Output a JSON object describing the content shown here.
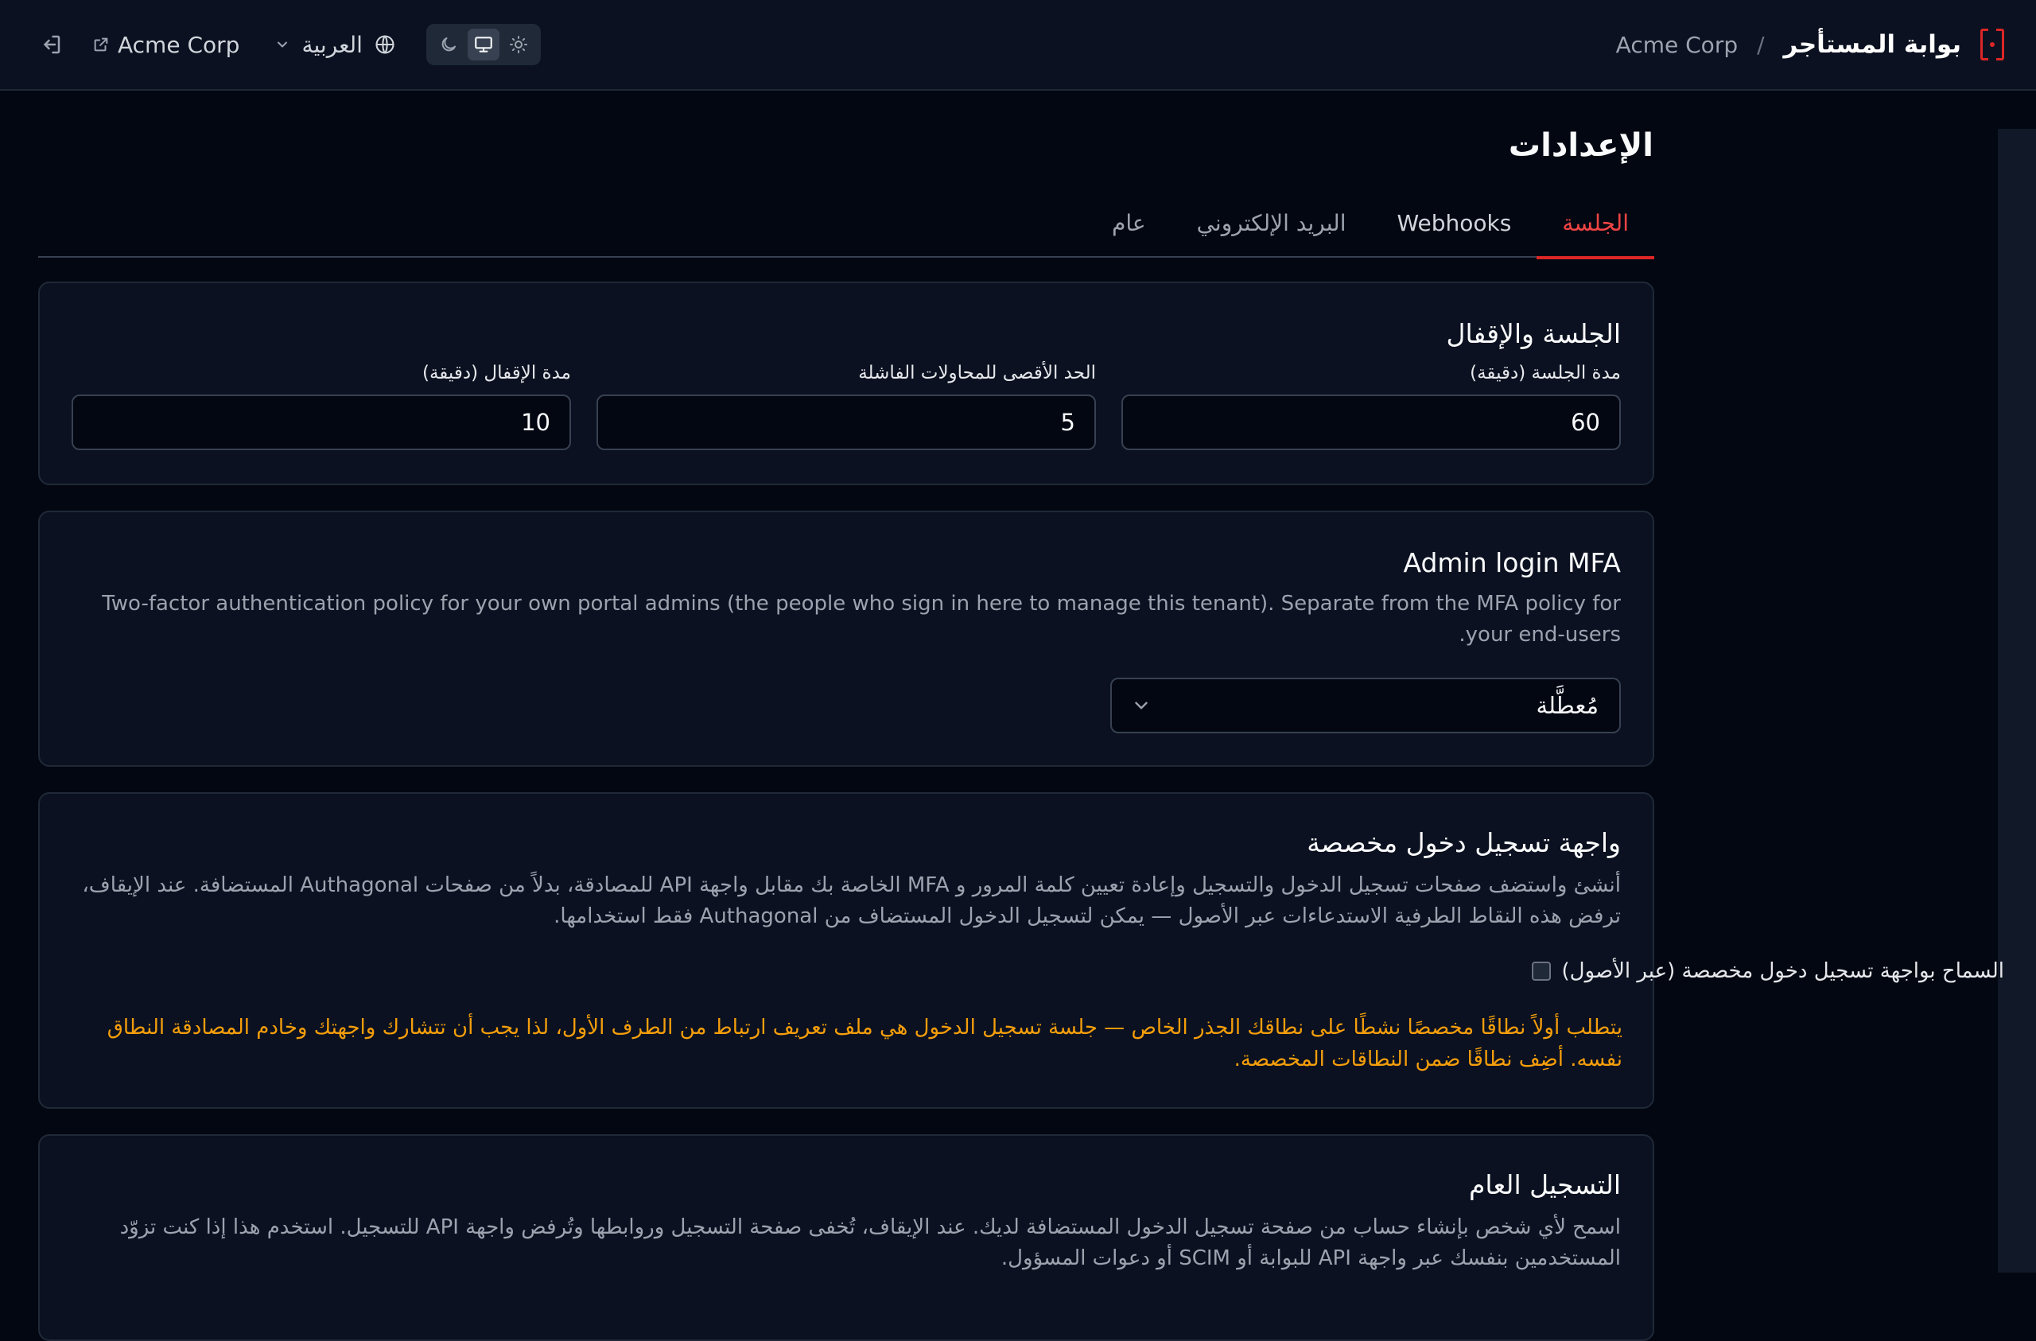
{
  "header": {
    "app_title": "بوابة المستأجر",
    "separator": "/",
    "tenant_name": "Acme Corp",
    "tenant_link_label": "Acme Corp",
    "language_label": "العربية",
    "theme_options": [
      "dark",
      "system",
      "light"
    ],
    "theme_selected": "system"
  },
  "page": {
    "title": "الإعدادات"
  },
  "tabs": [
    {
      "label": "الجلسة",
      "active": true
    },
    {
      "label": "Webhooks",
      "active": false
    },
    {
      "label": "البريد الإلكتروني",
      "active": false
    },
    {
      "label": "عام",
      "active": false
    }
  ],
  "session_card": {
    "title": "الجلسة والإقفال",
    "session_duration_label": "مدة الجلسة (دقيقة)",
    "session_duration_value": "60",
    "max_failed_label": "الحد الأقصى للمحاولات الفاشلة",
    "max_failed_value": "5",
    "lockout_label": "مدة الإقفال (دقيقة)",
    "lockout_value": "10"
  },
  "mfa_card": {
    "title": "Admin login MFA",
    "description": "Two-factor authentication policy for your own portal admins (the people who sign in here to manage this tenant). Separate from the MFA policy for your end-users.",
    "select_value": "مُعطَّلة"
  },
  "custom_login_card": {
    "title": "واجهة تسجيل دخول مخصصة",
    "description": "أنشئ واستضف صفحات تسجيل الدخول والتسجيل وإعادة تعيين كلمة المرور و MFA الخاصة بك مقابل واجهة API للمصادقة، بدلاً من صفحات Authagonal المستضافة. عند الإيقاف، ترفض هذه النقاط الطرفية الاستدعاءات عبر الأصول — يمكن لتسجيل الدخول المستضاف من Authagonal فقط استخدامها.",
    "checkbox_label": "السماح بواجهة تسجيل دخول مخصصة (عبر الأصول)",
    "checkbox_checked": false,
    "warning": "يتطلب أولاً نطاقًا مخصصًا نشطًا على نطاقك الجذر الخاص — جلسة تسجيل الدخول هي ملف تعريف ارتباط من الطرف الأول، لذا يجب أن تتشارك واجهتك وخادم المصادقة النطاق نفسه. أضِف نطاقًا ضمن النطاقات المخصصة."
  },
  "public_signup_card": {
    "title": "التسجيل العام",
    "description": "اسمح لأي شخص بإنشاء حساب من صفحة تسجيل الدخول المستضافة لديك. عند الإيقاف، تُخفى صفحة التسجيل وروابطها وتُرفض واجهة API للتسجيل. استخدم هذا إذا كنت تزوّد المستخدمين بنفسك عبر واجهة API للبوابة أو SCIM أو دعوات المسؤول."
  },
  "colors": {
    "accent": "#dc2626",
    "warning": "#f59e0b",
    "background": "#030712",
    "card": "#0b1120"
  }
}
